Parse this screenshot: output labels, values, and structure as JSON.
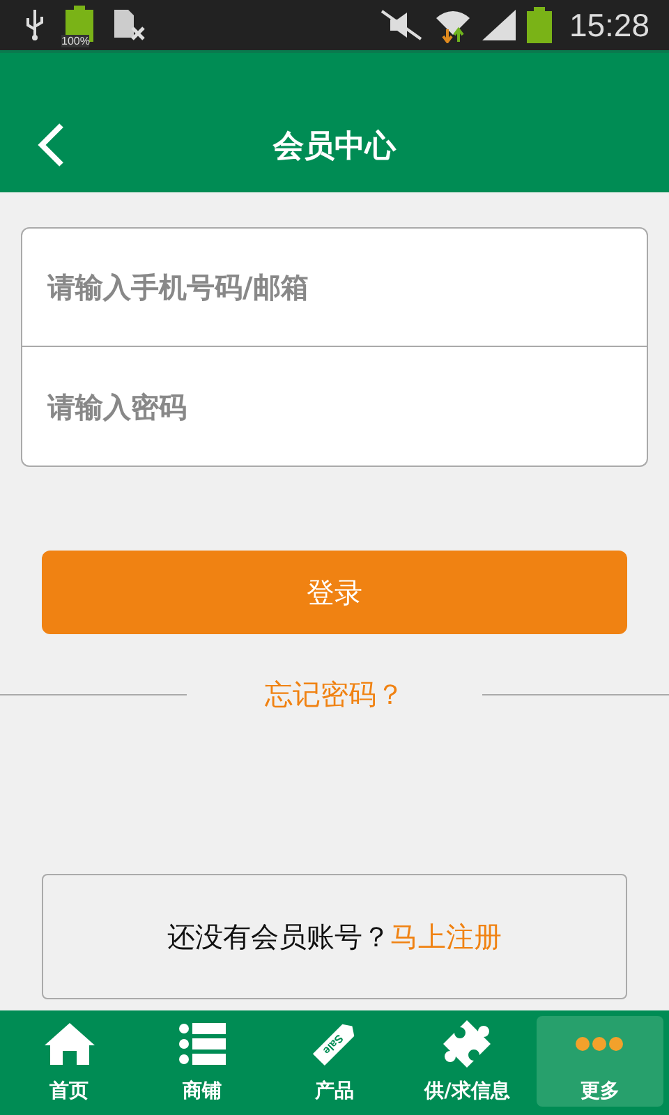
{
  "status_bar": {
    "battery_text": "100%",
    "time": "15:28"
  },
  "header": {
    "title": "会员中心"
  },
  "login_form": {
    "fields": [
      {
        "placeholder": "请输入手机号码/邮箱"
      },
      {
        "placeholder": "请输入密码"
      }
    ]
  },
  "login_button": "登录",
  "forgot_link": "忘记密码？",
  "register": {
    "text": "还没有会员账号？",
    "link": "马上注册"
  },
  "tab_bar": [
    {
      "label": "首页",
      "kind": "home",
      "selected": false
    },
    {
      "label": "商铺",
      "kind": "list",
      "selected": false
    },
    {
      "label": "产品",
      "kind": "tag",
      "icon_text": "Sale",
      "selected": false
    },
    {
      "label": "供/求信息",
      "kind": "puzzle",
      "selected": false
    },
    {
      "label": "更多",
      "kind": "dots",
      "selected": true
    }
  ]
}
